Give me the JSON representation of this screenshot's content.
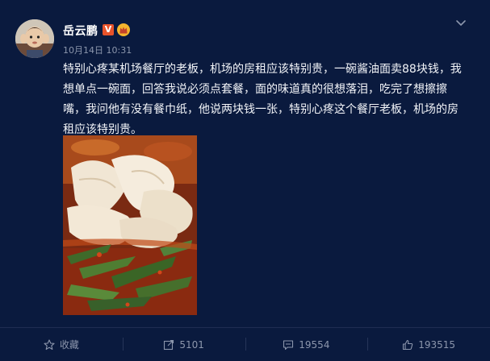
{
  "post": {
    "username": "岳云鹏",
    "verified_badge": "V",
    "timestamp": "10月14日 10:31",
    "text": "特别心疼某机场餐厅的老板，机场的房租应该特别贵，一碗酱油面卖88块钱，我想单点一碗面，回答我说必须点套餐，面的味道真的很想落泪，吃完了想擦擦嘴，我问他有没有餐巾纸，他说两块钱一张，特别心疼这个餐厅老板，机场的房租应该特别贵。",
    "icons": {
      "avatar": "avatar",
      "verified": "verified-v-icon",
      "crown": "crown-icon",
      "menu": "chevron-down-icon",
      "photo": "noodle-photo"
    }
  },
  "actions": {
    "favorite": {
      "label": "收藏",
      "icon": "star-icon"
    },
    "repost": {
      "count": "5101",
      "icon": "repost-icon"
    },
    "comment": {
      "count": "19554",
      "icon": "comment-icon"
    },
    "like": {
      "count": "193515",
      "icon": "thumbs-up-icon"
    }
  },
  "colors": {
    "background": "#0a1a3e",
    "text": "#f2f4f8",
    "muted": "#8c96ac",
    "verified": "#e8532a",
    "crown": "#f5b52e"
  }
}
